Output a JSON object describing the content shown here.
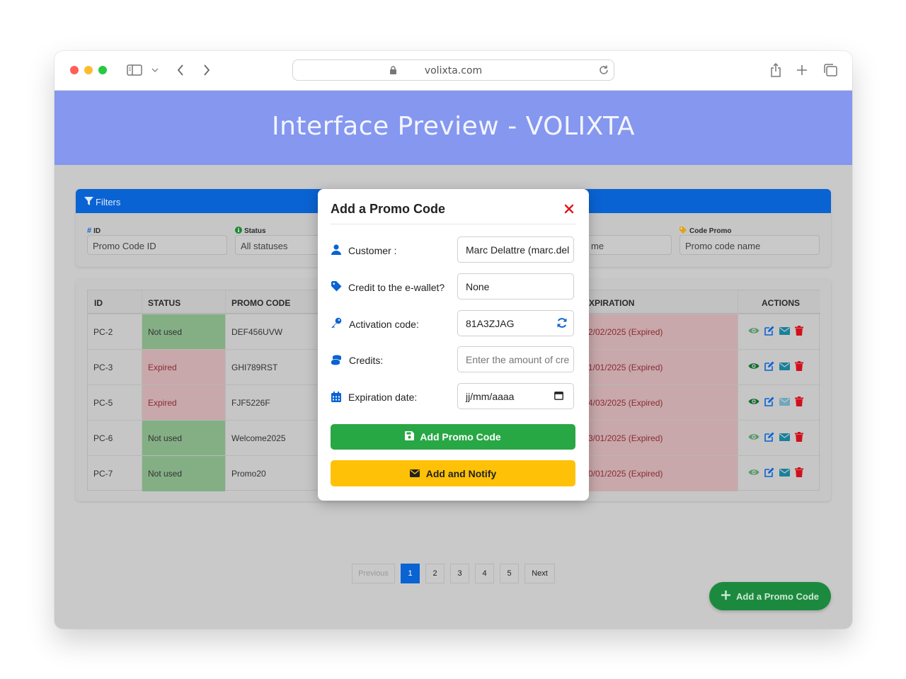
{
  "browser": {
    "url": "volixta.com"
  },
  "hero": {
    "title": "Interface Preview - VOLIXTA"
  },
  "filters": {
    "header": "Filters",
    "fields": [
      {
        "label": "ID",
        "placeholder": "Promo Code ID",
        "icon": "hash-icon"
      },
      {
        "label": "Status",
        "value": "All statuses",
        "icon": "info-circle-icon"
      },
      {
        "label": "",
        "placeholder": "me",
        "icon": ""
      },
      {
        "label": "Code Promo",
        "placeholder": "Promo code name",
        "icon": "tag-icon"
      }
    ]
  },
  "table": {
    "headers": {
      "id": "ID",
      "status": "STATUS",
      "promo": "PROMO CODE",
      "expiration": "XPIRATION",
      "actions": "ACTIONS"
    },
    "rows": [
      {
        "id": "PC-2",
        "status": "Not used",
        "promo": "DEF456UVW",
        "expiration": "2/02/2025 (Expired)",
        "view_muted": true,
        "email_muted": false
      },
      {
        "id": "PC-3",
        "status": "Expired",
        "promo": "GHI789RST",
        "expiration": "1/01/2025 (Expired)",
        "view_muted": false,
        "email_muted": false
      },
      {
        "id": "PC-5",
        "status": "Expired",
        "promo": "FJF5226F",
        "expiration": "4/03/2025 (Expired)",
        "view_muted": false,
        "email_muted": true
      },
      {
        "id": "PC-6",
        "status": "Not used",
        "promo": "Welcome2025",
        "expiration": "3/01/2025 (Expired)",
        "view_muted": true,
        "email_muted": false
      },
      {
        "id": "PC-7",
        "status": "Not used",
        "promo": "Promo20",
        "expiration": "0/01/2025 (Expired)",
        "view_muted": true,
        "email_muted": false
      }
    ]
  },
  "pagination": {
    "previous": "Previous",
    "pages": [
      "1",
      "2",
      "3",
      "4",
      "5"
    ],
    "next": "Next",
    "active": "1"
  },
  "fab": {
    "label": "Add a Promo Code"
  },
  "modal": {
    "title": "Add a Promo Code",
    "fields": {
      "customer": {
        "label": "Customer :",
        "value": "Marc Delattre (marc.del"
      },
      "credit_wallet": {
        "label": "Credit to the e-wallet?",
        "value": "None"
      },
      "activation": {
        "label": "Activation code:",
        "value": "81A3ZJAG"
      },
      "credits": {
        "label": "Credits:",
        "placeholder": "Enter the amount of cre"
      },
      "expiration": {
        "label": "Expiration date:",
        "placeholder": "jj/mm/aaaa"
      }
    },
    "add_button": "Add Promo Code",
    "notify_button": "Add and Notify"
  },
  "colors": {
    "hero": "#8597ef",
    "primary": "#0a63d3",
    "success": "#28a745",
    "warning": "#ffc107",
    "danger": "#dc3545"
  }
}
